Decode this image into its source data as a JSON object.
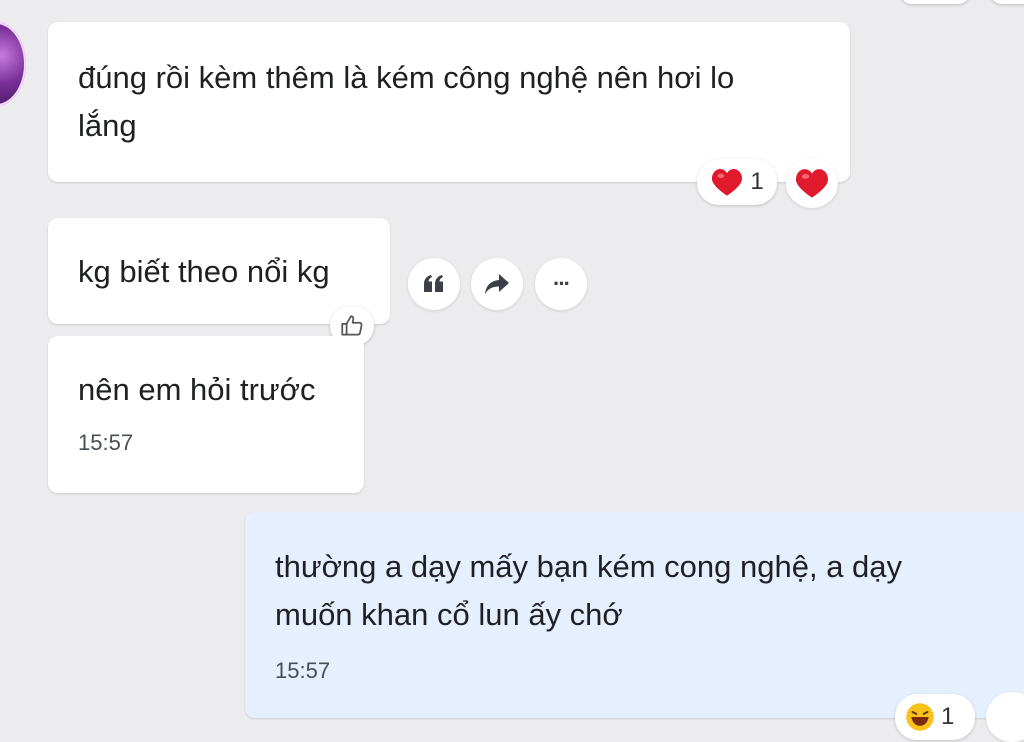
{
  "messages": [
    {
      "text": "đúng rồi kèm thêm là kém công nghệ nên hơi lo\nlắng",
      "reaction_count": "1",
      "reaction_icon": "heart-icon",
      "quick_react_icon": "heart-icon"
    },
    {
      "text": "kg biết theo nổi kg",
      "actions": [
        "quote-icon",
        "share-icon",
        "more-icon"
      ],
      "more_label": "···"
    },
    {
      "text": "nên em hỏi trước",
      "time": "15:57"
    },
    {
      "text": "thường a dạy mấy bạn kém cong nghệ, a dạy\nmuốn khan cổ lun ấy chớ",
      "time": "15:57",
      "reaction_count": "1",
      "reaction_icon": "laughing-emoji-icon"
    }
  ],
  "colors": {
    "background": "#ececef",
    "incoming_bubble": "#ffffff",
    "outgoing_bubble": "#e6effd",
    "heart": "#e0192d"
  }
}
